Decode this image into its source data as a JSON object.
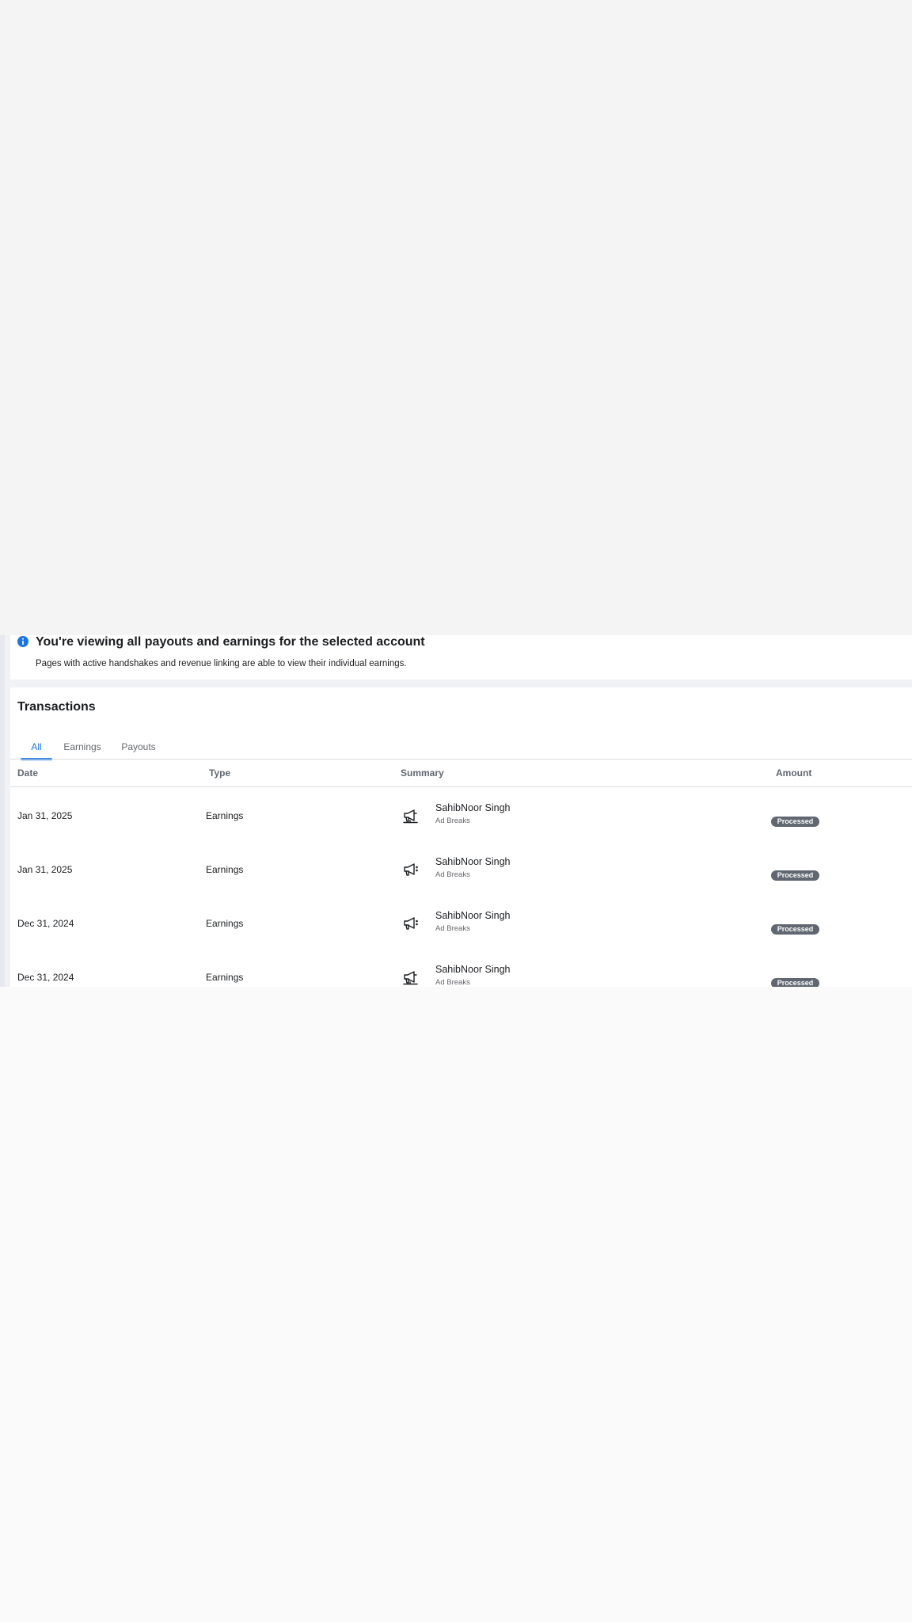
{
  "notice": {
    "title": "You're viewing all payouts and earnings for the selected account",
    "text": "Pages with active handshakes and revenue linking are able to view their individual earnings.",
    "icon": "info-icon",
    "icon_color": "#1b74e4"
  },
  "transactions": {
    "title": "Transactions",
    "tabs": [
      {
        "label": "All",
        "active": true
      },
      {
        "label": "Earnings",
        "active": false
      },
      {
        "label": "Payouts",
        "active": false
      }
    ],
    "columns": {
      "date": "Date",
      "type": "Type",
      "summary": "Summary",
      "amount": "Amount"
    },
    "rows": [
      {
        "date": "Jan 31, 2025",
        "type": "Earnings",
        "name": "SahibNoor Singh",
        "sub": "Ad Breaks",
        "status": "Processed",
        "icon": "ad-breaks-icon"
      },
      {
        "date": "Jan 31, 2025",
        "type": "Earnings",
        "name": "SahibNoor Singh",
        "sub": "Ad Breaks",
        "status": "Processed",
        "icon": "megaphone-icon"
      },
      {
        "date": "Dec 31, 2024",
        "type": "Earnings",
        "name": "SahibNoor Singh",
        "sub": "Ad Breaks",
        "status": "Processed",
        "icon": "megaphone-icon"
      },
      {
        "date": "Dec 31, 2024",
        "type": "Earnings",
        "name": "SahibNoor Singh",
        "sub": "Ad Breaks",
        "status": "Processed",
        "icon": "ad-breaks-icon"
      }
    ]
  },
  "colors": {
    "accent": "#1b74e4",
    "badge_bg": "#606770",
    "page_bg": "#f1f2f5"
  }
}
